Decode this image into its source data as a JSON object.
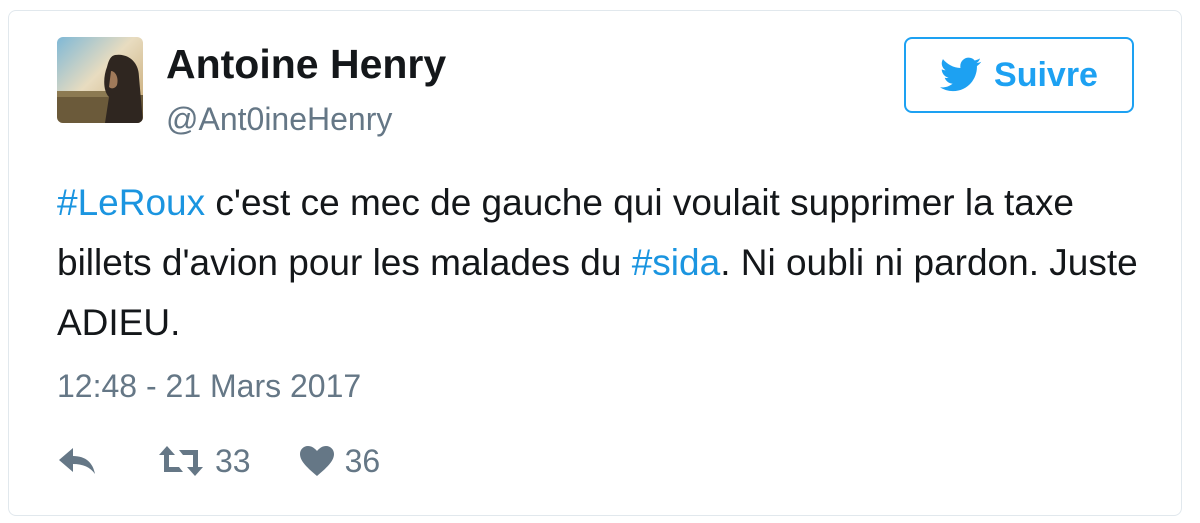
{
  "author": {
    "name": "Antoine Henry",
    "handle": "@Ant0ineHenry",
    "avatar_icon": "profile-photo"
  },
  "follow_button": {
    "label": "Suivre",
    "icon": "twitter-bird-icon",
    "color": "#1da1f2"
  },
  "tweet": {
    "segments": [
      {
        "text": "#LeRoux",
        "type": "hashtag"
      },
      {
        "text": " c'est ce mec de gauche qui voulait supprimer la taxe billets d'avion pour les malades du ",
        "type": "text"
      },
      {
        "text": "#sida",
        "type": "hashtag"
      },
      {
        "text": ". Ni oubli ni pardon. Juste ADIEU.",
        "type": "text"
      }
    ],
    "timestamp": "12:48 - 21 Mars 2017"
  },
  "actions": {
    "reply": {
      "icon": "reply-icon"
    },
    "retweet": {
      "icon": "retweet-icon",
      "count": "33"
    },
    "like": {
      "icon": "heart-icon",
      "count": "36"
    }
  },
  "colors": {
    "hashtag": "#1b95e0",
    "muted": "#657786",
    "text": "#14171a",
    "border": "#e1e8ed"
  }
}
